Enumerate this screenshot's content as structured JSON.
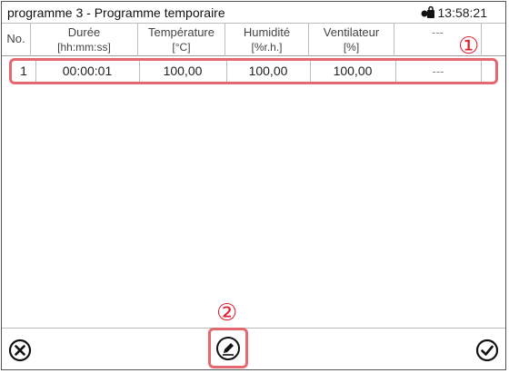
{
  "window": {
    "title": "programme 3 - Programme temporaire",
    "time": "13:58:21",
    "lock_icon": "lock-icon"
  },
  "table": {
    "columns": [
      {
        "name": "No.",
        "unit": ""
      },
      {
        "name": "Durée",
        "unit": "[hh:mm:ss]"
      },
      {
        "name": "Température",
        "unit": "[°C]"
      },
      {
        "name": "Humidité",
        "unit": "[%r.h.]"
      },
      {
        "name": "Ventilateur",
        "unit": "[%]"
      },
      {
        "name": "---",
        "unit": ""
      }
    ],
    "rows": [
      [
        "1",
        "00:00:01",
        "100,00",
        "100,00",
        "100,00",
        "---"
      ]
    ]
  },
  "annotations": {
    "marker_1": "①",
    "marker_2": "②",
    "color": "#e02030"
  },
  "footer": {
    "cancel_icon": "close-circle-icon",
    "edit_icon": "edit-pencil-icon",
    "confirm_icon": "check-circle-icon"
  }
}
